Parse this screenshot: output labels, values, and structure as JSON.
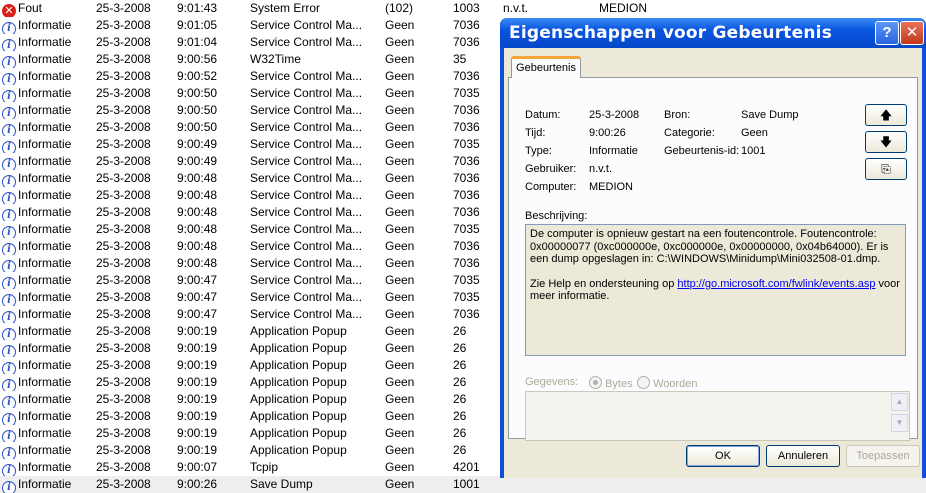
{
  "event_list": {
    "rows": [
      {
        "type": "Fout",
        "icon": "error-icon",
        "date": "25-3-2008",
        "time": "9:01:43",
        "source": "System Error",
        "category": "(102)",
        "event": "1003",
        "user": "n.v.t.",
        "computer": "MEDION"
      },
      {
        "type": "Informatie",
        "icon": "info-icon",
        "date": "25-3-2008",
        "time": "9:01:05",
        "source": "Service Control Ma...",
        "category": "Geen",
        "event": "7036",
        "user": "",
        "computer": ""
      },
      {
        "type": "Informatie",
        "icon": "info-icon",
        "date": "25-3-2008",
        "time": "9:01:04",
        "source": "Service Control Ma...",
        "category": "Geen",
        "event": "7036",
        "user": "",
        "computer": ""
      },
      {
        "type": "Informatie",
        "icon": "info-icon",
        "date": "25-3-2008",
        "time": "9:00:56",
        "source": "W32Time",
        "category": "Geen",
        "event": "35",
        "user": "",
        "computer": ""
      },
      {
        "type": "Informatie",
        "icon": "info-icon",
        "date": "25-3-2008",
        "time": "9:00:52",
        "source": "Service Control Ma...",
        "category": "Geen",
        "event": "7036",
        "user": "",
        "computer": ""
      },
      {
        "type": "Informatie",
        "icon": "info-icon",
        "date": "25-3-2008",
        "time": "9:00:50",
        "source": "Service Control Ma...",
        "category": "Geen",
        "event": "7035",
        "user": "",
        "computer": ""
      },
      {
        "type": "Informatie",
        "icon": "info-icon",
        "date": "25-3-2008",
        "time": "9:00:50",
        "source": "Service Control Ma...",
        "category": "Geen",
        "event": "7036",
        "user": "",
        "computer": ""
      },
      {
        "type": "Informatie",
        "icon": "info-icon",
        "date": "25-3-2008",
        "time": "9:00:50",
        "source": "Service Control Ma...",
        "category": "Geen",
        "event": "7036",
        "user": "",
        "computer": ""
      },
      {
        "type": "Informatie",
        "icon": "info-icon",
        "date": "25-3-2008",
        "time": "9:00:49",
        "source": "Service Control Ma...",
        "category": "Geen",
        "event": "7035",
        "user": "",
        "computer": ""
      },
      {
        "type": "Informatie",
        "icon": "info-icon",
        "date": "25-3-2008",
        "time": "9:00:49",
        "source": "Service Control Ma...",
        "category": "Geen",
        "event": "7036",
        "user": "",
        "computer": ""
      },
      {
        "type": "Informatie",
        "icon": "info-icon",
        "date": "25-3-2008",
        "time": "9:00:48",
        "source": "Service Control Ma...",
        "category": "Geen",
        "event": "7036",
        "user": "",
        "computer": ""
      },
      {
        "type": "Informatie",
        "icon": "info-icon",
        "date": "25-3-2008",
        "time": "9:00:48",
        "source": "Service Control Ma...",
        "category": "Geen",
        "event": "7036",
        "user": "",
        "computer": ""
      },
      {
        "type": "Informatie",
        "icon": "info-icon",
        "date": "25-3-2008",
        "time": "9:00:48",
        "source": "Service Control Ma...",
        "category": "Geen",
        "event": "7036",
        "user": "",
        "computer": ""
      },
      {
        "type": "Informatie",
        "icon": "info-icon",
        "date": "25-3-2008",
        "time": "9:00:48",
        "source": "Service Control Ma...",
        "category": "Geen",
        "event": "7035",
        "user": "",
        "computer": ""
      },
      {
        "type": "Informatie",
        "icon": "info-icon",
        "date": "25-3-2008",
        "time": "9:00:48",
        "source": "Service Control Ma...",
        "category": "Geen",
        "event": "7036",
        "user": "",
        "computer": ""
      },
      {
        "type": "Informatie",
        "icon": "info-icon",
        "date": "25-3-2008",
        "time": "9:00:48",
        "source": "Service Control Ma...",
        "category": "Geen",
        "event": "7036",
        "user": "",
        "computer": ""
      },
      {
        "type": "Informatie",
        "icon": "info-icon",
        "date": "25-3-2008",
        "time": "9:00:47",
        "source": "Service Control Ma...",
        "category": "Geen",
        "event": "7035",
        "user": "",
        "computer": ""
      },
      {
        "type": "Informatie",
        "icon": "info-icon",
        "date": "25-3-2008",
        "time": "9:00:47",
        "source": "Service Control Ma...",
        "category": "Geen",
        "event": "7035",
        "user": "",
        "computer": ""
      },
      {
        "type": "Informatie",
        "icon": "info-icon",
        "date": "25-3-2008",
        "time": "9:00:47",
        "source": "Service Control Ma...",
        "category": "Geen",
        "event": "7036",
        "user": "",
        "computer": ""
      },
      {
        "type": "Informatie",
        "icon": "info-icon",
        "date": "25-3-2008",
        "time": "9:00:19",
        "source": "Application Popup",
        "category": "Geen",
        "event": "26",
        "user": "",
        "computer": ""
      },
      {
        "type": "Informatie",
        "icon": "info-icon",
        "date": "25-3-2008",
        "time": "9:00:19",
        "source": "Application Popup",
        "category": "Geen",
        "event": "26",
        "user": "",
        "computer": ""
      },
      {
        "type": "Informatie",
        "icon": "info-icon",
        "date": "25-3-2008",
        "time": "9:00:19",
        "source": "Application Popup",
        "category": "Geen",
        "event": "26",
        "user": "",
        "computer": ""
      },
      {
        "type": "Informatie",
        "icon": "info-icon",
        "date": "25-3-2008",
        "time": "9:00:19",
        "source": "Application Popup",
        "category": "Geen",
        "event": "26",
        "user": "",
        "computer": ""
      },
      {
        "type": "Informatie",
        "icon": "info-icon",
        "date": "25-3-2008",
        "time": "9:00:19",
        "source": "Application Popup",
        "category": "Geen",
        "event": "26",
        "user": "",
        "computer": ""
      },
      {
        "type": "Informatie",
        "icon": "info-icon",
        "date": "25-3-2008",
        "time": "9:00:19",
        "source": "Application Popup",
        "category": "Geen",
        "event": "26",
        "user": "",
        "computer": ""
      },
      {
        "type": "Informatie",
        "icon": "info-icon",
        "date": "25-3-2008",
        "time": "9:00:19",
        "source": "Application Popup",
        "category": "Geen",
        "event": "26",
        "user": "",
        "computer": ""
      },
      {
        "type": "Informatie",
        "icon": "info-icon",
        "date": "25-3-2008",
        "time": "9:00:19",
        "source": "Application Popup",
        "category": "Geen",
        "event": "26",
        "user": "",
        "computer": ""
      },
      {
        "type": "Informatie",
        "icon": "info-icon",
        "date": "25-3-2008",
        "time": "9:00:07",
        "source": "Tcpip",
        "category": "Geen",
        "event": "4201",
        "user": "",
        "computer": ""
      },
      {
        "type": "Informatie",
        "icon": "info-icon",
        "date": "25-3-2008",
        "time": "9:00:26",
        "source": "Save Dump",
        "category": "Geen",
        "event": "1001",
        "user": "",
        "computer": "",
        "selected": true
      }
    ]
  },
  "dialog": {
    "title": "Eigenschappen voor Gebeurtenis",
    "help_glyph": "?",
    "close_glyph": "✕",
    "tab_label": "Gebeurtenis",
    "fields": {
      "date_label": "Datum:",
      "date_value": "25-3-2008",
      "time_label": "Tijd:",
      "time_value": "9:00:26",
      "type_label": "Type:",
      "type_value": "Informatie",
      "user_label": "Gebruiker:",
      "user_value": "n.v.t.",
      "computer_label": "Computer:",
      "computer_value": "MEDION",
      "source_label": "Bron:",
      "source_value": "Save Dump",
      "category_label": "Categorie:",
      "category_value": "Geen",
      "eventid_label": "Gebeurtenis-id:",
      "eventid_value": "1001"
    },
    "nav_buttons": {
      "up": "🡅",
      "down": "🡇",
      "copy": "⎘"
    },
    "description_label": "Beschrijving:",
    "description_text": "De computer is opnieuw gestart na een foutencontrole. Foutencontrole: 0x00000077 (0xc000000e, 0xc000000e, 0x00000000, 0x04b64000). Er is een dump opgeslagen in: C:\\WINDOWS\\Minidump\\Mini032508-01.dmp.",
    "help_text_prefix": "Zie Help en ondersteuning op ",
    "help_link": "http://go.microsoft.com/fwlink/events.asp",
    "help_text_suffix": " voor meer informatie.",
    "data_label": "Gegevens:",
    "radio_bytes": "Bytes",
    "radio_words": "Woorden",
    "scroll_up_glyph": "▲",
    "scroll_down_glyph": "▼",
    "ok_label": "OK",
    "cancel_label": "Annuleren",
    "apply_label": "Toepassen"
  }
}
